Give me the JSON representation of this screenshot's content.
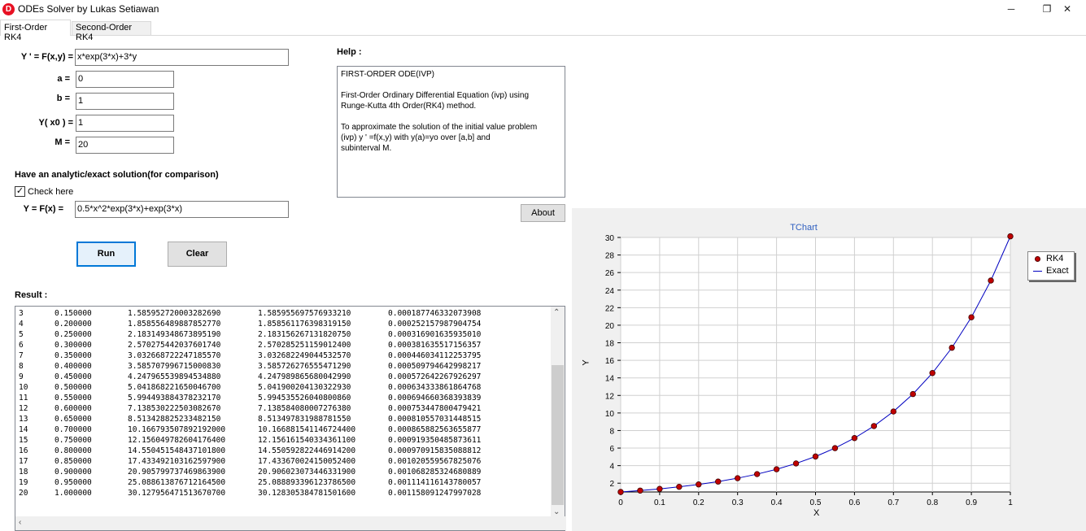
{
  "window": {
    "title": "ODEs Solver by Lukas Setiawan",
    "icon": "D",
    "minimize": "─",
    "maximize": "❐",
    "close": "✕"
  },
  "tabs": [
    {
      "label": "First-Order RK4"
    },
    {
      "label": "Second-Order RK4"
    }
  ],
  "form": {
    "fxy_label": "Y ' = F(x,y) =",
    "fxy_value": "x*exp(3*x)+3*y",
    "a_label": "a =",
    "a_value": "0",
    "b_label": "b =",
    "b_value": "1",
    "y0_label": "Y( x0 ) =",
    "y0_value": "1",
    "m_label": "M =",
    "m_value": "20",
    "analytic_heading": "Have an analytic/exact solution(for comparison)",
    "check_label": "Check here",
    "check_mark": "✓",
    "exact_label": "Y = F(x) =",
    "exact_value": "0.5*x^2*exp(3*x)+exp(3*x)"
  },
  "buttons": {
    "run": "Run",
    "clear": "Clear",
    "about": "About"
  },
  "help": {
    "label": "Help :",
    "text": "FIRST-ORDER ODE(IVP)\n\nFirst-Order Ordinary Differential Equation (ivp) using\nRunge-Kutta 4th Order(RK4) method.\n\nTo approximate the solution of the initial value problem\n(ivp) y ' =f(x,y) with y(a)=yo over [a,b] and\nsubinterval M."
  },
  "result": {
    "label": "Result :",
    "rows": [
      [
        "3",
        "0.150000",
        "1.585952720003282690",
        "1.585955697576933210",
        "0.000187746332073908"
      ],
      [
        "4",
        "0.200000",
        "1.858556489887852770",
        "1.858561176398319150",
        "0.000252157987904754"
      ],
      [
        "5",
        "0.250000",
        "2.183149348673895190",
        "2.183156267131820750",
        "0.000316901635935010"
      ],
      [
        "6",
        "0.300000",
        "2.570275442037601740",
        "2.570285251159012400",
        "0.000381635517156357"
      ],
      [
        "7",
        "0.350000",
        "3.032668722247185570",
        "3.032682249044532570",
        "0.000446034112253795"
      ],
      [
        "8",
        "0.400000",
        "3.585707996715000830",
        "3.585726276555471290",
        "0.000509794642998217"
      ],
      [
        "9",
        "0.450000",
        "4.247965539894534880",
        "4.247989865680042990",
        "0.000572642267926297"
      ],
      [
        "10",
        "0.500000",
        "5.041868221650046700",
        "5.041900204130322930",
        "0.000634333861864768"
      ],
      [
        "11",
        "0.550000",
        "5.994493884378232170",
        "5.994535526040800860",
        "0.000694660368393839"
      ],
      [
        "12",
        "0.600000",
        "7.138530222503082670",
        "7.138584080007276380",
        "0.000753447800479421"
      ],
      [
        "13",
        "0.650000",
        "8.513428825233482150",
        "8.513497831988781550",
        "0.000810557031448515"
      ],
      [
        "14",
        "0.700000",
        "10.166793507892192000",
        "10.166881541146724400",
        "0.000865882563655877"
      ],
      [
        "15",
        "0.750000",
        "12.156049782604176400",
        "12.156161540334361100",
        "0.000919350485873611"
      ],
      [
        "16",
        "0.800000",
        "14.550451548437101800",
        "14.550592822446914200",
        "0.000970915835088812"
      ],
      [
        "17",
        "0.850000",
        "17.433492103162597900",
        "17.433670024150052400",
        "0.001020559567825076"
      ],
      [
        "18",
        "0.900000",
        "20.905799737469863900",
        "20.906023073446331900",
        "0.001068285324680889"
      ],
      [
        "19",
        "0.950000",
        "25.088613876712164500",
        "25.088893396123786500",
        "0.001114116143780057"
      ],
      [
        "20",
        "1.000000",
        "30.127956471513670700",
        "30.128305384781501600",
        "0.001158091247997028"
      ]
    ]
  },
  "chart_data": {
    "type": "line",
    "title": "TChart",
    "xlabel": "X",
    "ylabel": "Y",
    "xlim": [
      0,
      1
    ],
    "ylim": [
      1,
      30
    ],
    "xticks": [
      "0",
      "0.1",
      "0.2",
      "0.3",
      "0.4",
      "0.5",
      "0.6",
      "0.7",
      "0.8",
      "0.9",
      "1"
    ],
    "yticks": [
      "2",
      "4",
      "6",
      "8",
      "10",
      "12",
      "14",
      "16",
      "18",
      "20",
      "22",
      "24",
      "26",
      "28",
      "30"
    ],
    "grid": true,
    "legend_position": "right",
    "series": [
      {
        "name": "RK4",
        "style": "points",
        "color": "#c00000",
        "x": [
          0,
          0.05,
          0.1,
          0.15,
          0.2,
          0.25,
          0.3,
          0.35,
          0.4,
          0.45,
          0.5,
          0.55,
          0.6,
          0.65,
          0.7,
          0.75,
          0.8,
          0.85,
          0.9,
          0.95,
          1.0
        ],
        "y": [
          1.0,
          1.16,
          1.35,
          1.586,
          1.859,
          2.183,
          2.57,
          3.033,
          3.586,
          4.248,
          5.042,
          5.994,
          7.139,
          8.513,
          10.167,
          12.156,
          14.55,
          17.433,
          20.906,
          25.089,
          30.128
        ]
      },
      {
        "name": "Exact",
        "style": "line",
        "color": "#0000c0",
        "x": [
          0,
          0.05,
          0.1,
          0.15,
          0.2,
          0.25,
          0.3,
          0.35,
          0.4,
          0.45,
          0.5,
          0.55,
          0.6,
          0.65,
          0.7,
          0.75,
          0.8,
          0.85,
          0.9,
          0.95,
          1.0
        ],
        "y": [
          1.0,
          1.16,
          1.35,
          1.586,
          1.859,
          2.183,
          2.57,
          3.033,
          3.586,
          4.248,
          5.042,
          5.994,
          7.139,
          8.513,
          10.167,
          12.156,
          14.551,
          17.434,
          20.906,
          25.089,
          30.128
        ]
      }
    ]
  }
}
